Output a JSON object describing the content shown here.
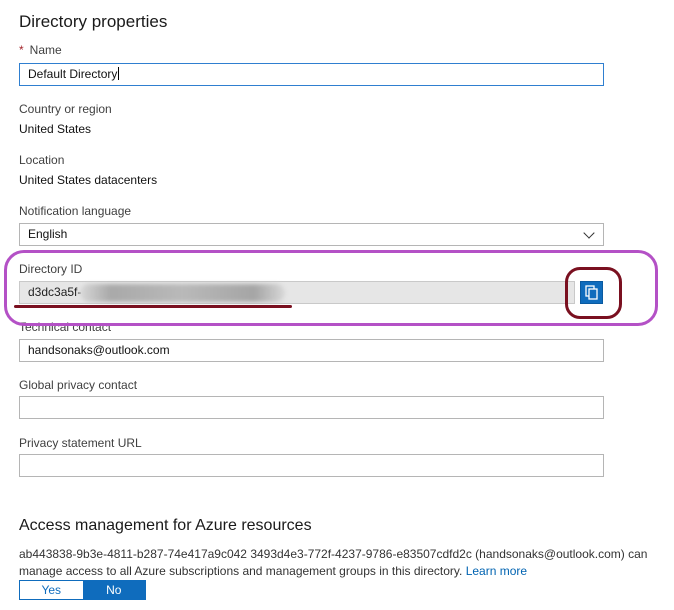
{
  "page": {
    "title": "Directory properties"
  },
  "fields": {
    "name": {
      "required_mark": "*",
      "label": "Name",
      "value": "Default Directory"
    },
    "country": {
      "label": "Country or region",
      "value": "United States"
    },
    "location": {
      "label": "Location",
      "value": "United States datacenters"
    },
    "notification_language": {
      "label": "Notification language",
      "value": "English"
    },
    "directory_id": {
      "label": "Directory ID",
      "value": "d3dc3a5f-"
    },
    "technical_contact": {
      "label": "Technical contact",
      "value": "handsonaks@outlook.com"
    },
    "global_privacy_contact": {
      "label": "Global privacy contact",
      "value": ""
    },
    "privacy_statement_url": {
      "label": "Privacy statement URL",
      "value": ""
    }
  },
  "access": {
    "title": "Access management for Azure resources",
    "description": "ab443838-9b3e-4811-b287-74e417a9c042 3493d4e3-772f-4237-9786-e83507cdfd2c (handsonaks@outlook.com) can manage access to all Azure subscriptions and management groups in this directory.",
    "learn_more": "Learn more",
    "toggle": {
      "yes": "Yes",
      "no": "No",
      "selected": "No"
    }
  },
  "icons": {
    "copy": "copy-icon",
    "dropdown": "chevron-down-icon"
  },
  "colors": {
    "accent": "#0f6cbd",
    "annotation_purple": "#b451c6",
    "annotation_red": "#7a1020"
  }
}
